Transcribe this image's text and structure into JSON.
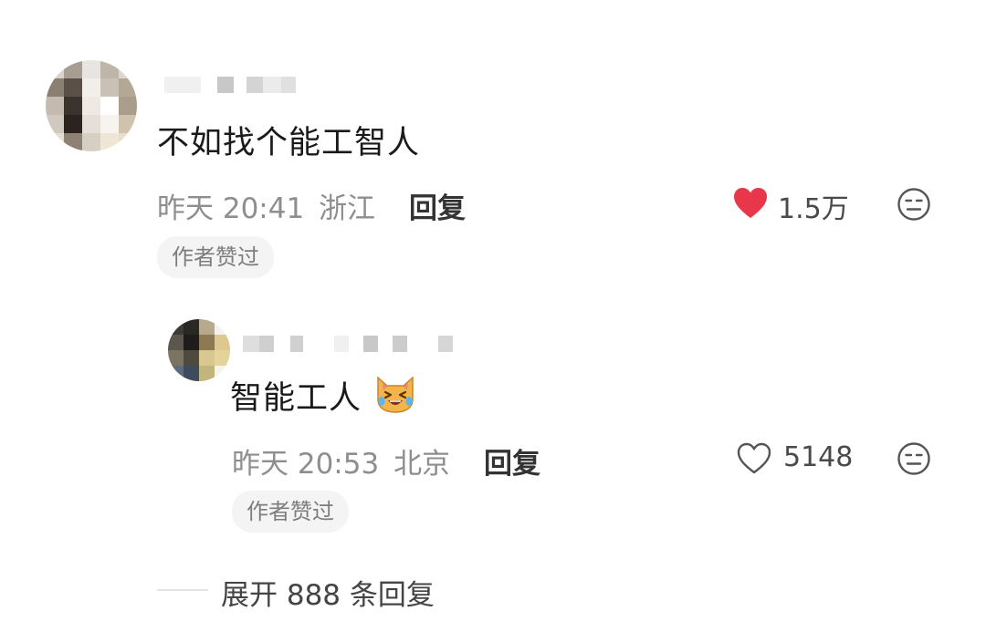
{
  "comments": [
    {
      "text": "不如找个能工智人",
      "time": "昨天 20:41",
      "location": "浙江",
      "reply_label": "回复",
      "likes": "1.5万",
      "liked": true,
      "badge": "作者赞过",
      "avatar_icon": "blurred-avatar",
      "like_icon": "heart-filled-icon",
      "more_icon": "neutral-face-icon"
    },
    {
      "text": "智能工人",
      "emoji": "crying-laughing-cat-emoji",
      "time": "昨天 20:53",
      "location": "北京",
      "reply_label": "回复",
      "likes": "5148",
      "liked": false,
      "badge": "作者赞过",
      "avatar_icon": "blurred-avatar",
      "like_icon": "heart-outline-icon",
      "more_icon": "neutral-face-icon"
    }
  ],
  "expand": {
    "label": "展开 888 条回复"
  },
  "colors": {
    "like_red": "#e8364a",
    "meta_gray": "#8e8e8e",
    "badge_bg": "#f4f4f4"
  }
}
